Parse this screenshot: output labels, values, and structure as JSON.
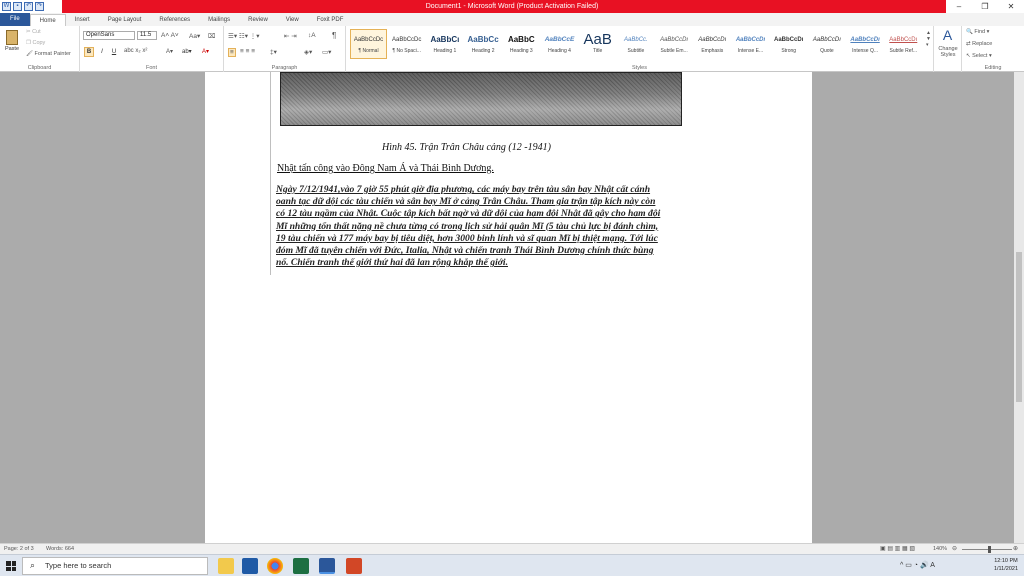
{
  "window": {
    "title": "Document1 - Microsoft Word (Product Activation Failed)",
    "controls": [
      "–",
      "❐",
      "✕"
    ]
  },
  "tabs": [
    "File",
    "Home",
    "Insert",
    "Page Layout",
    "References",
    "Mailings",
    "Review",
    "View",
    "Foxit PDF"
  ],
  "clipboard": {
    "paste": "Paste",
    "cut": "Cut",
    "copy": "Copy",
    "painter": "Format Painter",
    "label": "Clipboard"
  },
  "font": {
    "name": "OpenSans",
    "size": "11.5",
    "label": "Font",
    "bold": "B",
    "italic": "I",
    "underline": "U"
  },
  "paragraph": {
    "label": "Paragraph",
    "pilcrow": "¶"
  },
  "styles": {
    "label": "Styles",
    "items": [
      {
        "preview": "AaBbCcDc",
        "name": "¶ Normal"
      },
      {
        "preview": "AaBbCcDc",
        "name": "¶ No Spaci..."
      },
      {
        "preview": "AaBbCı",
        "name": "Heading 1"
      },
      {
        "preview": "AaBbCc",
        "name": "Heading 2"
      },
      {
        "preview": "AaBbC",
        "name": "Heading 3"
      },
      {
        "preview": "AaBbCcE",
        "name": "Heading 4"
      },
      {
        "preview": "AaB",
        "name": "Title"
      },
      {
        "preview": "AaBbCc.",
        "name": "Subtitle"
      },
      {
        "preview": "AaBbCcDı",
        "name": "Subtle Em..."
      },
      {
        "preview": "AaBbCcDı",
        "name": "Emphasis"
      },
      {
        "preview": "AaBbCcDı",
        "name": "Intense E..."
      },
      {
        "preview": "AaBbCcDı",
        "name": "Strong"
      },
      {
        "preview": "AaBbCcDı",
        "name": "Quote"
      },
      {
        "preview": "AaBbCcDı",
        "name": "Intense Q..."
      },
      {
        "preview": "AaBbCcDı",
        "name": "Subtle Ref..."
      }
    ],
    "change": "Change Styles"
  },
  "editing": {
    "label": "Editing",
    "find": "Find",
    "replace": "Replace",
    "select": "Select"
  },
  "doc": {
    "caption": "Hình 45. Trận Trân Châu cảng (12  -1941)",
    "heading": "  Nhật tấn công vào Đông Nam Á và Thái Bình Dương.   ",
    "lines": [
      "Ngày 7/12/1941,vào 7 giờ 55 phút giờ địa phương, các máy bay trên tàu sân bay Nhật cất cánh",
      "oanh tạc dữ dội các tàu chiến và sân bay Mĩ ở cảng Trân Châu. Tham gia trận tập kích này còn",
      "có 12 tàu ngầm của Nhật. Cuộc tập kích bất ngờ và dữ dội của hạm đội Nhật đã gây cho hạm đội",
      "Mĩ những tổn thất nặng nề chưa từng có trong lịch sử hải quân Mĩ (5 tàu chủ lực bị đánh chìm,",
      "19 tàu chiến và 177 máy bay bị tiêu diệt, hơn 3000 binh lính và sĩ quan Mĩ bị thiệt mạng. Tới lúc",
      "đóm Mĩ đã tuyên chiến với Đức, Italia, Nhật và chiến tranh Thái Bình Dương chính thức bùng",
      "nổ. Chiến tranh thế giới thứ hai đã lan rộng khắp thế giới."
    ]
  },
  "status": {
    "page": "Page: 2 of 3",
    "words": "Words: 664",
    "zoom": "140%"
  },
  "taskbar": {
    "search": "Type here to search",
    "time": "12:10 PM",
    "date": "1/11/2021"
  }
}
